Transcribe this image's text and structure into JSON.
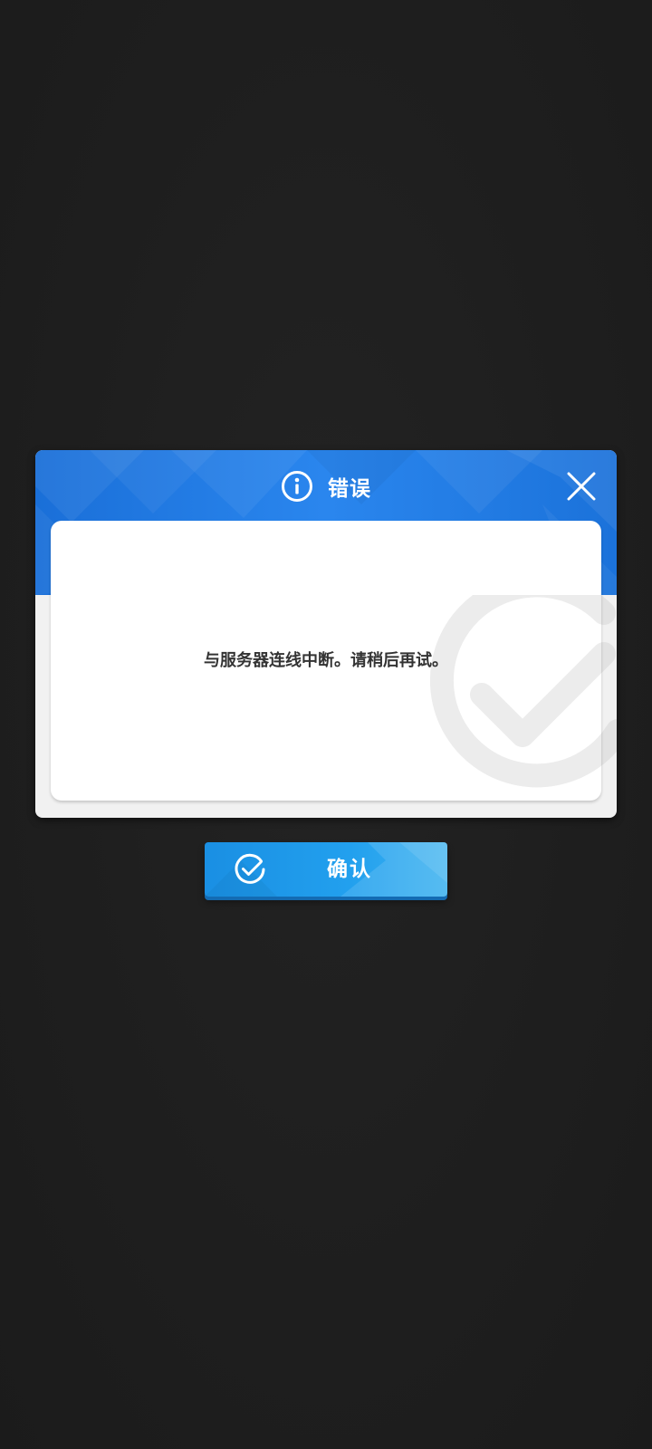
{
  "dialog": {
    "title": "错误",
    "message": "与服务器连线中断。请稍后再试。",
    "title_icon": "info-icon",
    "close_icon": "close-icon",
    "watermark_icon": "check-circle-icon"
  },
  "confirm": {
    "label": "确认",
    "icon": "check-circle-icon"
  },
  "colors": {
    "background": "#1f1f1f",
    "header_blue": "#1a6fd8",
    "button_blue": "#22a0ee",
    "text_dark": "#333333"
  }
}
